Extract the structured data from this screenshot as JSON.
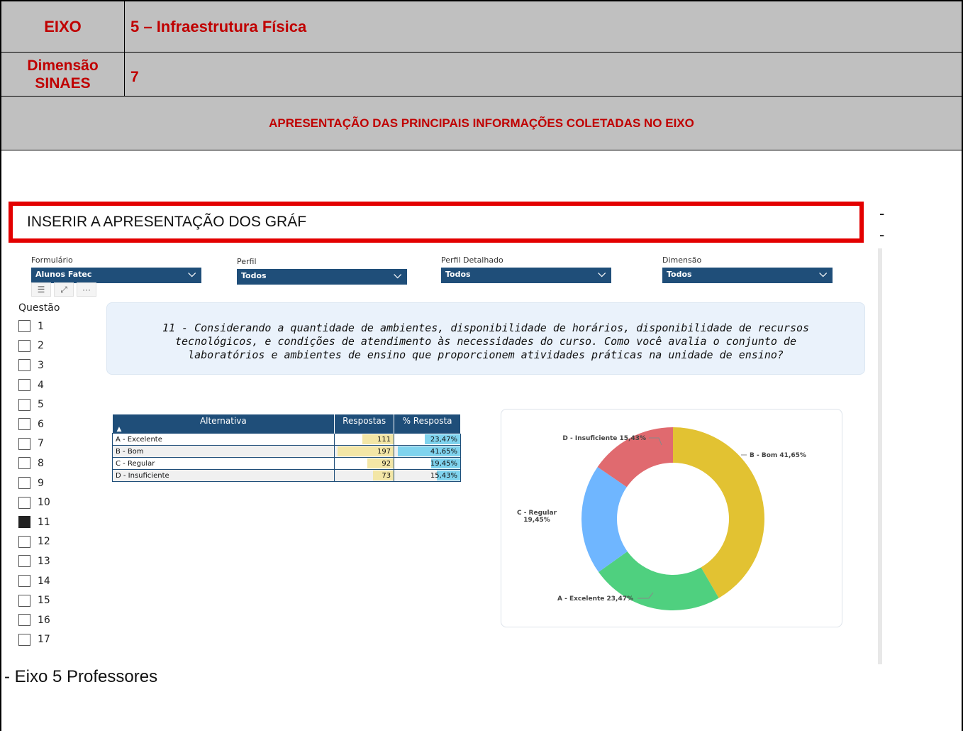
{
  "header": {
    "eixo_label": "EIXO",
    "eixo_value": "5 – Infraestrutura Física",
    "dimensao_label_line1": "Dimensão",
    "dimensao_label_line2": "SINAES",
    "dimensao_value": "7",
    "section_title": "APRESENTAÇÃO DAS PRINCIPAIS INFORMAÇÕES COLETADAS NO EIXO"
  },
  "insert_box_text": "INSERIR A APRESENTAÇÃO DOS GRÁF",
  "side_dashes": [
    "-",
    "-"
  ],
  "footer_text": "- Eixo 5 Professores",
  "dashboard": {
    "filters": [
      {
        "label": "Formulário",
        "value": "Alunos Fatec"
      },
      {
        "label": "Perfil",
        "value": "Todos"
      },
      {
        "label": "Perfil Detalhado",
        "value": "Todos"
      },
      {
        "label": "Dimensão",
        "value": "Todos"
      }
    ],
    "toolbar_icons": [
      "filter-icon",
      "focus-mode-icon",
      "more-options-icon"
    ],
    "question_slicer_label": "Questão",
    "questions": [
      "1",
      "2",
      "3",
      "4",
      "5",
      "6",
      "7",
      "8",
      "9",
      "10",
      "11",
      "12",
      "13",
      "14",
      "15",
      "16",
      "17"
    ],
    "selected_question": "11",
    "question_text": "11 - Considerando a quantidade de ambientes, disponibilidade de horários, disponibilidade de recursos tecnológicos, e condições de atendimento às necessidades do curso. Como você avalia o conjunto de laboratórios e ambientes de ensino que proporcionem atividades práticas na unidade de ensino?",
    "table": {
      "headers": [
        "Alternativa",
        "Respostas",
        "% Resposta"
      ],
      "rows": [
        {
          "alt": "A - Excelente",
          "resp": "111",
          "pct": "23,47%"
        },
        {
          "alt": "B - Bom",
          "resp": "197",
          "pct": "41,65%"
        },
        {
          "alt": "C - Regular",
          "resp": "92",
          "pct": "19,45%"
        },
        {
          "alt": "D - Insuficiente",
          "resp": "73",
          "pct": "15,43%"
        }
      ]
    }
  },
  "chart_data": {
    "type": "pie",
    "donut": true,
    "categories": [
      "B - Bom",
      "A - Excelente",
      "C - Regular",
      "D - Insuficiente"
    ],
    "values": [
      41.65,
      23.47,
      19.45,
      15.43
    ],
    "labels": [
      "B - Bom 41,65%",
      "A - Excelente 23,47%",
      "C - Regular 19,45%",
      "D - Insuficiente 15,43%"
    ],
    "colors": [
      "#e2c232",
      "#4fd07f",
      "#6fb6ff",
      "#e06a6f"
    ]
  }
}
